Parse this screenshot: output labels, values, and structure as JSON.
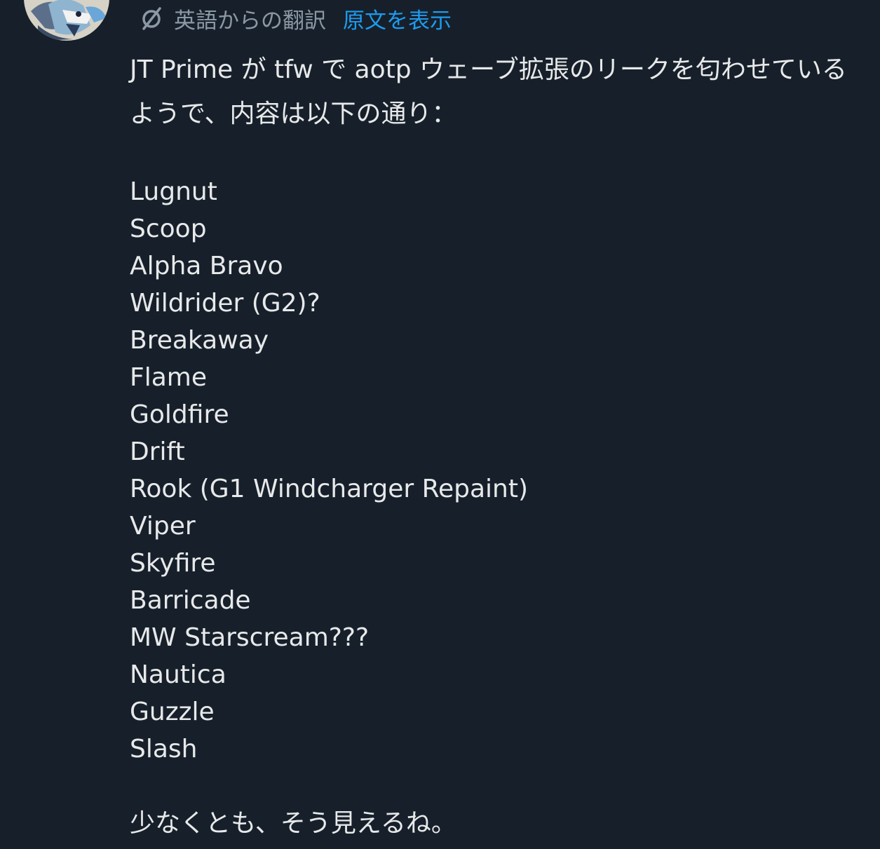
{
  "translation": {
    "icon": "translate-icon",
    "label": "英語からの翻訳",
    "show_original_label": "原文を表示",
    "link_color": "#1d9bf0"
  },
  "tweet": {
    "intro": "JT Prime が tfw で aotp ウェーブ拡張のリークを匂わせているようで、内容は以下の通り：",
    "items": [
      "Lugnut",
      "Scoop",
      "Alpha Bravo",
      "Wildrider (G2)?",
      "Breakaway",
      "Flame",
      "Goldfire",
      "Drift",
      "Rook (G1 Windcharger Repaint)",
      "Viper",
      "Skyfire",
      "Barricade",
      "MW Starscream???",
      "Nautica",
      "Guzzle",
      "Slash"
    ],
    "outro": "少なくとも、そう見えるね。"
  },
  "colors": {
    "background": "#17202a",
    "text": "#e7e9ea",
    "muted": "#8b98a5"
  }
}
